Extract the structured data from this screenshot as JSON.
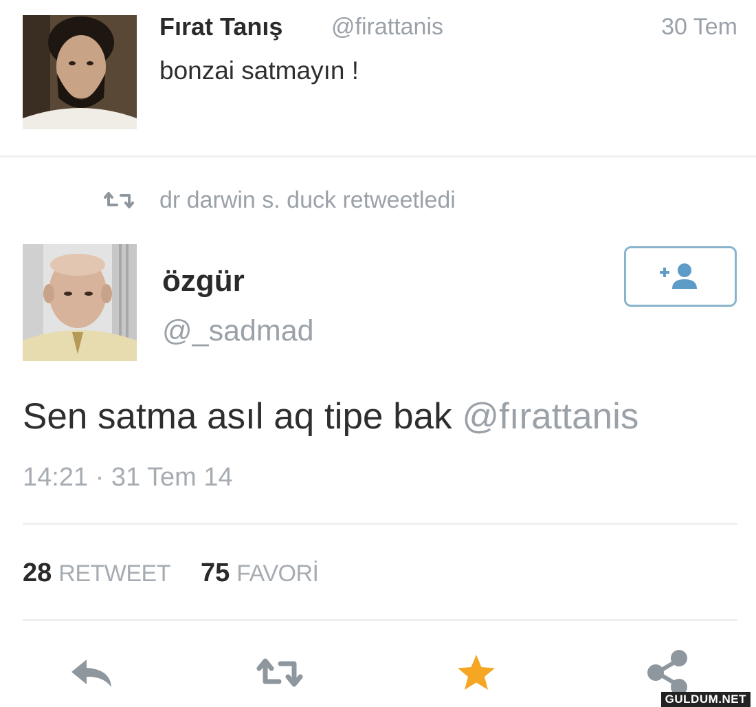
{
  "tweet1": {
    "name": "Fırat Tanış",
    "handle": "@firattanis",
    "date": "30 Tem",
    "text": "bonzai satmayın !"
  },
  "retweet_bar": {
    "text": "dr darwin s. duck retweetledi",
    "icon": "retweet-icon"
  },
  "tweet2": {
    "name": "özgür",
    "handle": "@_sadmad",
    "follow_icon": "add-user-icon",
    "text": "Sen satma asıl aq tipe bak",
    "mention": "@fırattanis",
    "timestamp": "14:21 · 31 Tem 14",
    "retweet_count": "28",
    "retweet_label": "RETWEET",
    "favorite_count": "75",
    "favorite_label": "FAVORİ"
  },
  "actions": [
    {
      "icon": "reply-icon"
    },
    {
      "icon": "retweet-icon"
    },
    {
      "icon": "star-icon",
      "color": "#f5a623"
    },
    {
      "icon": "share-icon"
    }
  ],
  "watermark": "GULDUM.NET",
  "colors": {
    "muted": "#9aa1a8",
    "accent": "#8ab3cc",
    "favorite": "#f5a623"
  }
}
